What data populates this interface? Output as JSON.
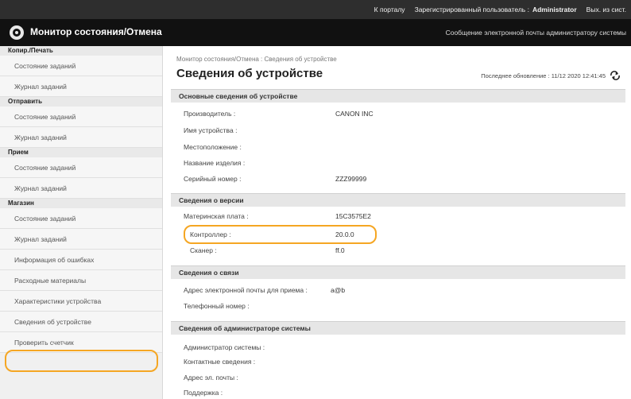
{
  "topbar": {
    "portal": "К порталу",
    "user_label": "Зарегистрированный пользователь :",
    "user_name": "Administrator",
    "logout": "Вых. из сист."
  },
  "titlebar": {
    "title": "Монитор состояния/Отмена",
    "mail_link": "Сообщение электронной почты администратору системы",
    "logo_icon": "monitor-logo-icon"
  },
  "sidebar": {
    "copy_print": {
      "label": "Копир./Печать",
      "items": [
        "Состояние заданий",
        "Журнал заданий"
      ]
    },
    "send": {
      "label": "Отправить",
      "items": [
        "Состояние заданий",
        "Журнал заданий"
      ]
    },
    "receive": {
      "label": "Прием",
      "items": [
        "Состояние заданий",
        "Журнал заданий"
      ]
    },
    "storage": {
      "label": "Магазин",
      "items": [
        "Состояние заданий",
        "Журнал заданий"
      ]
    },
    "other": [
      "Информация об ошибках",
      "Расходные материалы",
      "Характеристики устройства",
      "Сведения об устройстве",
      "Проверить счетчик"
    ]
  },
  "main": {
    "breadcrumb": "Монитор состояния/Отмена : Сведения об устройстве",
    "title": "Сведения об устройстве",
    "last_update": "Последнее обновление : 11/12 2020 12:41:45"
  },
  "sections": {
    "basic": {
      "title": "Основные сведения об устройстве",
      "manufacturer_label": "Производитель :",
      "manufacturer_value": "CANON INC",
      "device_name_label": "Имя устройства :",
      "location_label": "Местоположение :",
      "product_name_label": "Название изделия :",
      "serial_label": "Серийный номер :",
      "serial_value": "ZZZ99999"
    },
    "version": {
      "title": "Сведения о версии",
      "motherboard_label": "Материнская плата :",
      "motherboard_value": "15C3575E2",
      "controller_label": "Контроллер :",
      "controller_value": "20.0.0",
      "scanner_label": "Сканер :",
      "scanner_value": "ff.0"
    },
    "contact": {
      "title": "Сведения о связи",
      "email_label": "Адрес электронной почты для приема :",
      "email_value": "a@b",
      "phone_label": "Телефонный номер :"
    },
    "admin": {
      "title": "Сведения об администраторе системы",
      "admin_label": "Администратор системы :",
      "contact_label": "Контактные сведения :",
      "email_label": "Адрес эл. почты :",
      "support_label": "Поддержка :"
    }
  },
  "colors": {
    "highlight": "#f5a623",
    "topbar": "#2e2e2e",
    "titlebar": "#111111"
  }
}
